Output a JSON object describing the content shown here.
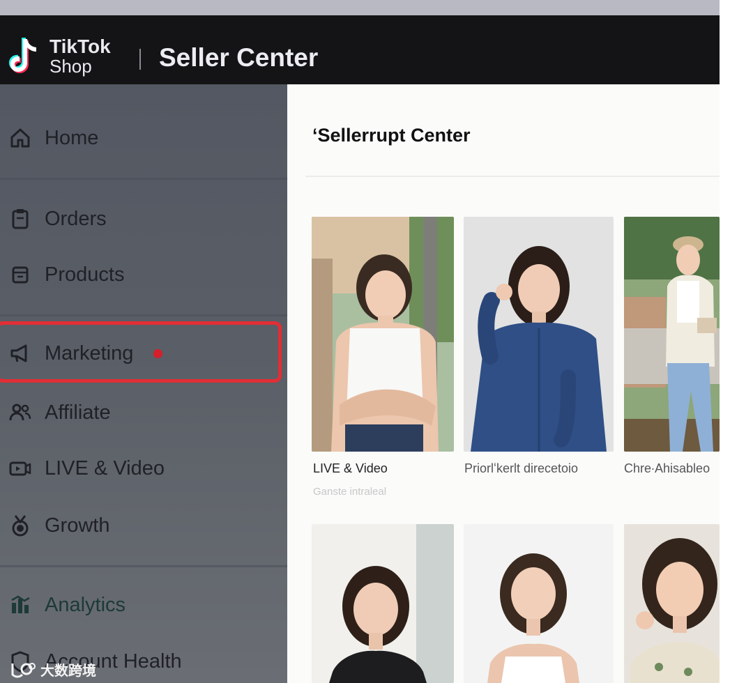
{
  "header": {
    "brand_line1": "TikTok",
    "brand_line2": "Shop",
    "title": "Seller Center"
  },
  "sidebar": {
    "items": [
      {
        "label": "Home",
        "icon": "home-icon"
      },
      {
        "label": "Orders",
        "icon": "clipboard-icon"
      },
      {
        "label": "Products",
        "icon": "box-icon"
      },
      {
        "label": "Marketing",
        "icon": "megaphone-icon",
        "highlighted": true,
        "notification_dot": true
      },
      {
        "label": "Affiliate",
        "icon": "people-icon"
      },
      {
        "label": "LIVE & Video",
        "icon": "video-icon"
      },
      {
        "label": "Growth",
        "icon": "medal-icon"
      },
      {
        "label": "Analytics",
        "icon": "bar-chart-icon"
      },
      {
        "label": "Account Health",
        "icon": "shield-icon"
      }
    ]
  },
  "main": {
    "title": "‘Sellerrupt Center",
    "cards": [
      {
        "caption": "LIVE & Video",
        "subcaption": "Ganste intraleal"
      },
      {
        "caption": "Priorlʻkerlt direcetoio",
        "subcaption": ""
      },
      {
        "caption": "Chre∙Ahisableo",
        "subcaption": ""
      }
    ]
  },
  "watermark": {
    "text": "大数跨境"
  },
  "colors": {
    "header_bg": "#141416",
    "sidebar_bg": "#555962",
    "highlight_border": "#e22e35",
    "notification_dot": "#d61f2c",
    "analytics_text": "#1d3a36"
  }
}
